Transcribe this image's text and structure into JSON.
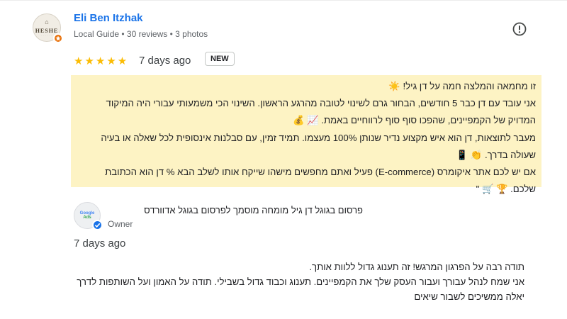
{
  "reviewer": {
    "name": "Eli Ben Itzhak",
    "meta": "Local Guide • 30 reviews • 3 photos",
    "avatar_text": "HESHE",
    "avatar_icon": "user-photo",
    "badge_icon": "local-guide-star-icon"
  },
  "review": {
    "stars_text": "★★★★★",
    "rating": 5,
    "date": "7 days ago",
    "badge": "NEW",
    "highlight_color": "#fdf3c4",
    "lines": [
      "זו מחמאה והמלצה חמה על דן גיל! ☀️",
      "אני עובד עם דן כבר 5 חודשים, הבחור גרם לשינוי לטובה מהרגע הראשון. השינוי הכי משמעותי עבורי היה המיקוד המדויק של הקמפיינים, שהפכו סוף סוף לרווחיים באמת. 📈 💰",
      "מעבר לתוצאות, דן הוא איש מקצוע נדיר שנותן 100% מעצמו. תמיד זמין, עם סבלנות אינסופית לכל שאלה או בעיה שעולה בדרך. 👏 📱",
      "אם יש לכם אתר איקומרס (E-commerce) פעיל ואתם מחפשים מישהו שייקח אותו לשלב הבא % דן הוא הכתובת שלכם. 🏆 🛒 \""
    ]
  },
  "owner": {
    "name": "פרסום בגוגל דן גיל מומחה מוסמך לפרסום בגוגל אדוורדס",
    "role": "Owner",
    "avatar_lines": [
      "Google",
      "Ads"
    ],
    "verified_icon": "verified-check-icon"
  },
  "reply": {
    "date": "7 days ago",
    "lines": [
      "תודה רבה על הפרגון המרגש! זה תענוג גדול ללוות אותך.",
      "אני שמח לנהל עבורך ועבור העסק שלך את הקמפיינים. תענוג וכבוד גדול בשבילי. תודה על האמון ועל השותפות לדרך יאלה ממשיכים לשבור שיאים"
    ]
  },
  "colors": {
    "link_blue": "#1a73e8",
    "star_yellow": "#fbbc04",
    "guide_orange": "#e8710a"
  }
}
